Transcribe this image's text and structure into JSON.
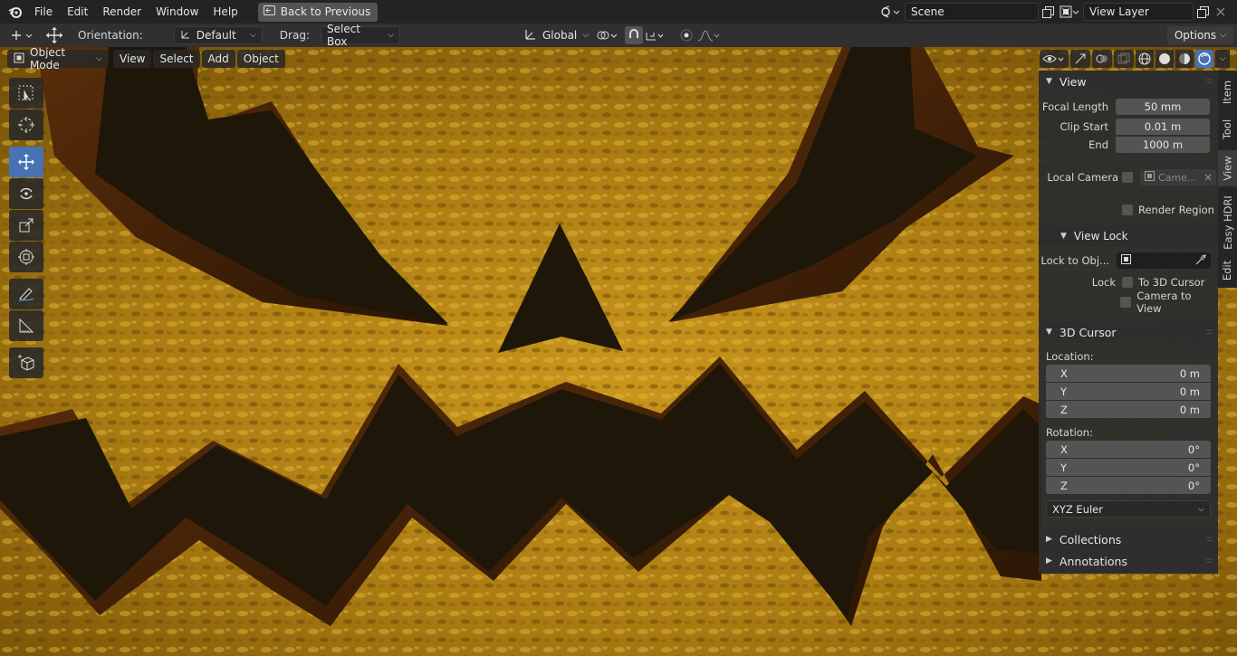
{
  "menu": {
    "items": [
      "File",
      "Edit",
      "Render",
      "Window",
      "Help"
    ],
    "back_label": "Back to Previous",
    "scene": "Scene",
    "view_layer": "View Layer"
  },
  "tool_settings": {
    "orientation_label": "Orientation:",
    "orientation_value": "Default",
    "drag_label": "Drag:",
    "drag_value": "Select Box",
    "transform_space": "Global",
    "options_label": "Options"
  },
  "viewport_header": {
    "mode": "Object Mode",
    "menus": [
      "View",
      "Select",
      "Add",
      "Object"
    ]
  },
  "npanel": {
    "tabs": [
      "Item",
      "Tool",
      "View",
      "Easy HDRI",
      "Edit"
    ],
    "active_tab": "View",
    "view_section": {
      "title": "View",
      "focal_length_label": "Focal Length",
      "focal_length": "50 mm",
      "clip_start_label": "Clip Start",
      "clip_start": "0.01 m",
      "end_label": "End",
      "end": "1000 m",
      "local_camera_label": "Local Camera",
      "local_camera_value": "Came...",
      "render_region_label": "Render Region"
    },
    "view_lock": {
      "title": "View Lock",
      "lock_to_obj_label": "Lock to Obj...",
      "lock_label": "Lock",
      "to_3d_cursor": "To 3D Cursor",
      "camera_to_view": "Camera to View"
    },
    "cursor_section": {
      "title": "3D Cursor",
      "location_label": "Location:",
      "location": [
        {
          "axis": "X",
          "value": "0 m"
        },
        {
          "axis": "Y",
          "value": "0 m"
        },
        {
          "axis": "Z",
          "value": "0 m"
        }
      ],
      "rotation_label": "Rotation:",
      "rotation": [
        {
          "axis": "X",
          "value": "0°"
        },
        {
          "axis": "Y",
          "value": "0°"
        },
        {
          "axis": "Z",
          "value": "0°"
        }
      ],
      "rotation_mode": "XYZ Euler"
    },
    "collapsed_sections": [
      "Collections",
      "Annotations"
    ]
  },
  "colors": {
    "accent": "#4772b3",
    "pumpkin": "#b8860b",
    "dark_cut": "#1c150a"
  }
}
